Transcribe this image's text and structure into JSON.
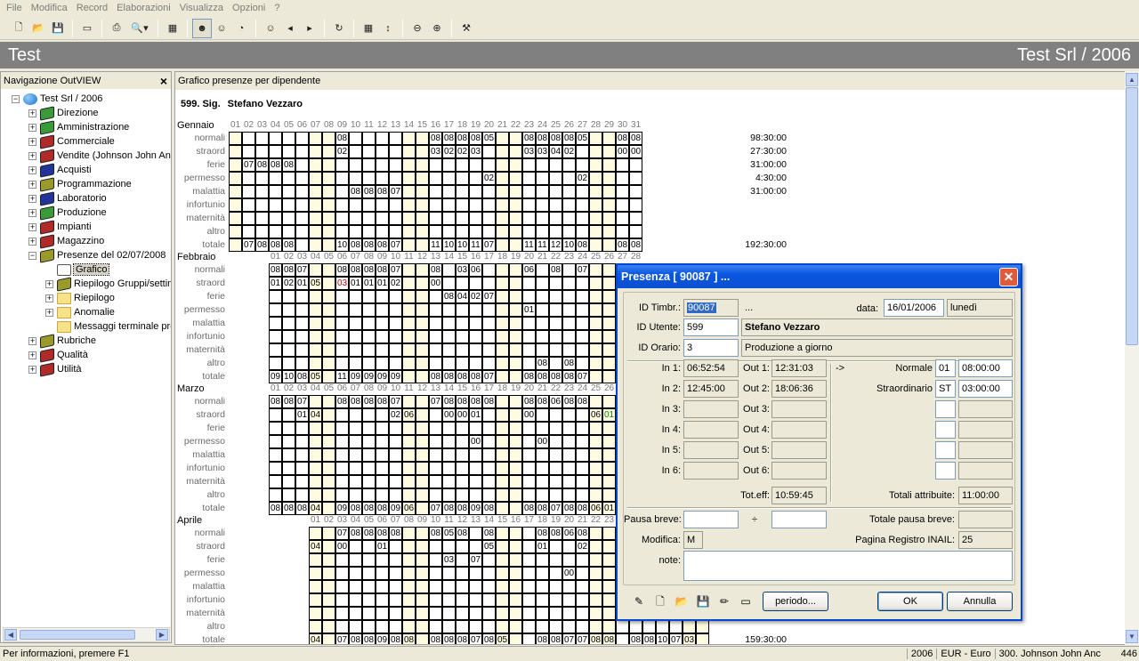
{
  "menu": [
    "File",
    "Modifica",
    "Record",
    "Elaborazioni",
    "Visualizza",
    "Opzioni",
    "?"
  ],
  "toolbar": {
    "icons": [
      "new-icon",
      "open-icon",
      "save-icon",
      "card-icon",
      "print-icon",
      "preview-icon",
      "report-icon",
      "users-icon",
      "users-color-icon",
      "users-gray-icon",
      "user-search-icon",
      "prev-icon",
      "next-icon",
      "refresh-icon",
      "report2-icon",
      "sort-icon",
      "zoom-out-icon",
      "zoom-in-icon",
      "tools-icon"
    ]
  },
  "title": {
    "left": "Test",
    "right": "Test Srl / 2006"
  },
  "left_pane": {
    "header": "Navigazione OutVIEW",
    "close": "×",
    "tree": [
      {
        "label": "Test Srl / 2006",
        "level": 0,
        "icon": "globe",
        "exp": "−"
      },
      {
        "label": "Direzione",
        "level": 1,
        "icon": "book",
        "color": "#3a9a3a",
        "exp": "+"
      },
      {
        "label": "Amministrazione",
        "level": 1,
        "icon": "book",
        "color": "#3a9a3a",
        "exp": "+"
      },
      {
        "label": "Commerciale",
        "level": 1,
        "icon": "book",
        "color": "#b02a2a",
        "exp": "+"
      },
      {
        "label": "Vendite (Johnson John Anc",
        "level": 1,
        "icon": "book",
        "color": "#b02a2a",
        "exp": "+"
      },
      {
        "label": "Acquisti",
        "level": 1,
        "icon": "book",
        "color": "#22339a",
        "exp": "+"
      },
      {
        "label": "Programmazione",
        "level": 1,
        "icon": "book",
        "color": "#9a9a2a",
        "exp": "+"
      },
      {
        "label": "Laboratorio",
        "level": 1,
        "icon": "book",
        "color": "#22339a",
        "exp": "+"
      },
      {
        "label": "Produzione",
        "level": 1,
        "icon": "book",
        "color": "#3a9a3a",
        "exp": "+"
      },
      {
        "label": "Impianti",
        "level": 1,
        "icon": "book",
        "color": "#b02a2a",
        "exp": "+"
      },
      {
        "label": "Magazzino",
        "level": 1,
        "icon": "book",
        "color": "#b02a2a",
        "exp": "+"
      },
      {
        "label": "Presenze del 02/07/2008",
        "level": 1,
        "icon": "book",
        "color": "#9a9a2a",
        "exp": "−"
      },
      {
        "label": "Grafico",
        "level": 2,
        "icon": "chart",
        "exp": "",
        "selected": true
      },
      {
        "label": "Riepilogo Gruppi/settim",
        "level": 2,
        "icon": "book",
        "color": "#9a9a2a",
        "exp": "+"
      },
      {
        "label": "Riepilogo",
        "level": 2,
        "icon": "folder",
        "exp": "+"
      },
      {
        "label": "Anomalie",
        "level": 2,
        "icon": "folder",
        "exp": "+"
      },
      {
        "label": "Messaggi terminale pre",
        "level": 2,
        "icon": "folder",
        "exp": ""
      },
      {
        "label": "Rubriche",
        "level": 1,
        "icon": "book",
        "color": "#9a9a2a",
        "exp": "+"
      },
      {
        "label": "Qualità",
        "level": 1,
        "icon": "book",
        "color": "#b02a2a",
        "exp": "+"
      },
      {
        "label": "Utilità",
        "level": 1,
        "icon": "book",
        "color": "#b02a2a",
        "exp": "+"
      }
    ]
  },
  "main": {
    "header": "Grafico presenze per dipendente",
    "employee_code": "599. Sig.",
    "employee_name": "Stefano Vezzaro",
    "row_labels": [
      "normali",
      "straord",
      "ferie",
      "permesso",
      "malattia",
      "infortunio",
      "maternità",
      "altro",
      "totale"
    ],
    "day_labels": [
      "01",
      "02",
      "03",
      "04",
      "05",
      "06",
      "07",
      "08",
      "09",
      "10",
      "11",
      "12",
      "13",
      "14",
      "15",
      "16",
      "17",
      "18",
      "19",
      "20",
      "21",
      "22",
      "23",
      "24",
      "25",
      "26",
      "27",
      "28",
      "29",
      "30",
      "31"
    ],
    "months": [
      {
        "name": "Gennaio",
        "days": 31,
        "offset": 0,
        "weekend": [
          1,
          7,
          8,
          14,
          15,
          21,
          22,
          28,
          29
        ],
        "rows": {
          "normali": {
            "9": "08",
            "16": "08",
            "17": "08",
            "18": "08",
            "19": "08",
            "20": "05",
            "23": "08",
            "24": "08",
            "25": "08",
            "26": "08",
            "27": "05",
            "30": "08",
            "31": "08"
          },
          "straord": {
            "9": "02",
            "16": "03",
            "17": "02",
            "18": "02",
            "19": "03",
            "23": "03",
            "24": "03",
            "25": "04",
            "26": "02",
            "30": "00",
            "31": "00"
          },
          "ferie": {
            "2": "07",
            "3": "08",
            "4": "08",
            "5": "08"
          },
          "permesso": {
            "20": "02",
            "27": "02"
          },
          "malattia": {
            "10": "08",
            "11": "08",
            "12": "08",
            "13": "07"
          },
          "infortunio": {},
          "maternità": {},
          "altro": {},
          "totale": {
            "2": "07",
            "3": "08",
            "4": "08",
            "5": "08",
            "9": "10",
            "10": "08",
            "11": "08",
            "12": "08",
            "13": "07",
            "16": "11",
            "17": "10",
            "18": "10",
            "19": "11",
            "20": "07",
            "23": "11",
            "24": "11",
            "25": "12",
            "26": "10",
            "27": "08",
            "30": "08",
            "31": "08"
          }
        },
        "totals": {
          "normali": "98:30:00",
          "straord": "27:30:00",
          "ferie": "31:00:00",
          "permesso": "4:30:00",
          "malattia": "31:00:00",
          "totale": "192:30:00"
        }
      },
      {
        "name": "Febbraio",
        "days": 28,
        "offset": 3,
        "weekend": [
          4,
          5,
          11,
          12,
          18,
          19,
          25,
          26
        ],
        "rows": {
          "normali": {
            "1": "08",
            "2": "08",
            "3": "07",
            "6": "08",
            "7": "08",
            "8": "08",
            "9": "08",
            "10": "07",
            "13": "08",
            "15": "03",
            "16": "06",
            "20": "06",
            "22": "08",
            "24": "07"
          },
          "straord": {
            "1": "01",
            "2": "02",
            "3": "01",
            "4": "05",
            "6": "03",
            "7": "01",
            "8": "01",
            "9": "01",
            "10": "02",
            "13": "00"
          },
          "ferie": {
            "14": "08",
            "15": "04",
            "16": "02",
            "17": "07"
          },
          "permesso": {
            "20": "01"
          },
          "malattia": {},
          "infortunio": {},
          "maternità": {},
          "altro": {
            "21": "08",
            "23": "08"
          },
          "totale": {
            "1": "09",
            "2": "10",
            "3": "08",
            "4": "05",
            "6": "11",
            "7": "09",
            "8": "09",
            "9": "09",
            "10": "09",
            "13": "08",
            "14": "08",
            "15": "08",
            "16": "08",
            "17": "07",
            "20": "08",
            "21": "08",
            "22": "08",
            "23": "08",
            "24": "07"
          }
        },
        "totals": {}
      },
      {
        "name": "Marzo",
        "days": 31,
        "offset": 3,
        "weekend": [
          4,
          5,
          11,
          12,
          18,
          19,
          25,
          26
        ],
        "rows": {
          "normali": {
            "1": "08",
            "2": "08",
            "3": "07",
            "6": "08",
            "7": "08",
            "8": "08",
            "9": "08",
            "10": "07",
            "13": "07",
            "14": "08",
            "15": "08",
            "16": "08",
            "17": "08",
            "20": "08",
            "21": "08",
            "22": "06",
            "23": "08",
            "24": "08"
          },
          "straord": {
            "3": "01",
            "4": "04",
            "10": "02",
            "11": "06",
            "14": "00",
            "15": "00",
            "16": "01",
            "20": "00",
            "25": "06",
            "26": "01"
          },
          "ferie": {},
          "permesso": {
            "16": "00",
            "21": "00"
          },
          "malattia": {},
          "infortunio": {},
          "maternità": {},
          "altro": {},
          "totale": {
            "1": "08",
            "2": "08",
            "3": "08",
            "4": "04",
            "6": "09",
            "7": "08",
            "8": "08",
            "9": "08",
            "10": "09",
            "11": "06",
            "13": "07",
            "14": "08",
            "15": "08",
            "16": "09",
            "17": "08",
            "20": "08",
            "21": "08",
            "22": "07",
            "23": "08",
            "24": "08",
            "25": "06",
            "26": "01"
          }
        },
        "totals": {}
      },
      {
        "name": "Aprile",
        "days": 30,
        "offset": 6,
        "weekend": [
          1,
          2,
          8,
          9,
          15,
          16,
          22,
          23,
          29,
          30
        ],
        "rows": {
          "normali": {
            "3": "07",
            "4": "08",
            "5": "08",
            "6": "08",
            "7": "08",
            "10": "08",
            "11": "05",
            "12": "08",
            "14": "08",
            "18": "08",
            "19": "08",
            "20": "06",
            "21": "08"
          },
          "straord": {
            "1": "04",
            "3": "00",
            "6": "01",
            "14": "05",
            "18": "01",
            "21": "02"
          },
          "ferie": {
            "11": "03",
            "13": "07"
          },
          "permesso": {
            "20": "00"
          },
          "malattia": {},
          "infortunio": {},
          "maternità": {},
          "altro": {},
          "totale": {
            "1": "04",
            "3": "07",
            "4": "08",
            "5": "08",
            "6": "09",
            "7": "08",
            "8": "08",
            "10": "08",
            "11": "08",
            "12": "08",
            "13": "07",
            "14": "08",
            "15": "05",
            "18": "08",
            "19": "08",
            "20": "07",
            "21": "07",
            "22": "08",
            "23": "08",
            "25": "08",
            "26": "08",
            "27": "10",
            "28": "07",
            "29": "03"
          }
        },
        "totals": {
          "totale": "159:30:00"
        }
      }
    ]
  },
  "dialog": {
    "title": "Presenza [ 90087 ] ...",
    "close": "✕",
    "id_timbr_label": "ID Timbr.:",
    "id_timbr": "90087",
    "ellipsis": "...",
    "data_label": "data:",
    "data": "16/01/2006",
    "weekday": "lunedì",
    "id_utente_label": "ID Utente:",
    "id_utente": "599",
    "utente_name": "Stefano Vezzaro",
    "id_orario_label": "ID Orario:",
    "id_orario": "3",
    "orario_name": "Produzione a giorno",
    "in_labels": [
      "In 1:",
      "In 2:",
      "In 3:",
      "In 4:",
      "In 5:",
      "In 6:"
    ],
    "out_labels": [
      "Out 1:",
      "Out 2:",
      "Out 3:",
      "Out 4:",
      "Out 5:",
      "Out 6:"
    ],
    "in_values": [
      "06:52:54",
      "12:45:00",
      "",
      "",
      "",
      ""
    ],
    "out_values": [
      "12:31:03",
      "18:06:36",
      "",
      "",
      "",
      ""
    ],
    "arrow": "->",
    "normale_label": "Normale",
    "normale_code": "01",
    "normale_value": "08:00:00",
    "straord_label": "Straordinario",
    "straord_code": "ST",
    "straord_value": "03:00:00",
    "toteff_label": "Tot.eff:",
    "toteff": "10:59:45",
    "totali_label": "Totali attribuite:",
    "totali": "11:00:00",
    "pausa_label": "Pausa breve:",
    "pausa_sep": "÷",
    "totpausa_label": "Totale pausa breve:",
    "modifica_label": "Modifica:",
    "modifica": "M",
    "inail_label": "Pagina Registro INAIL:",
    "inail": "25",
    "note_label": "note:",
    "periodo_button": "periodo...",
    "ok_button": "OK",
    "cancel_button": "Annulla"
  },
  "status": {
    "help": "Per informazioni, premere F1",
    "year": "2006",
    "currency": "EUR - Euro",
    "user": "300. Johnson John Anc",
    "extra": "446"
  }
}
